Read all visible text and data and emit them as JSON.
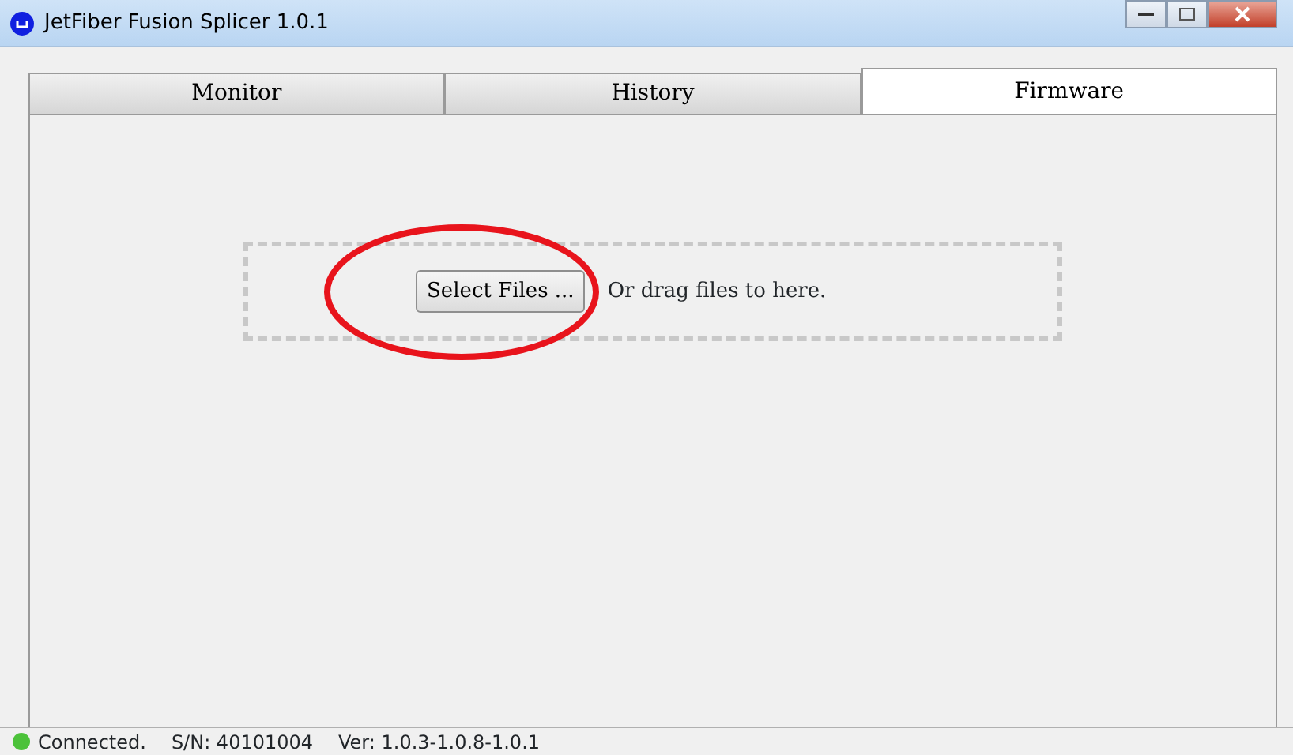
{
  "window": {
    "title": "JetFiber Fusion Splicer 1.0.1"
  },
  "tabs": [
    {
      "label": "Monitor",
      "selected": false
    },
    {
      "label": "History",
      "selected": false
    },
    {
      "label": "Firmware",
      "selected": true
    }
  ],
  "drop_zone": {
    "button": "Select Files ...",
    "hint": "Or drag files to here."
  },
  "status_bar": {
    "connected": true,
    "connection": "Connected.",
    "serial": "S/N: 40101004",
    "version": "Ver: 1.0.3-1.0.8-1.0.1"
  }
}
